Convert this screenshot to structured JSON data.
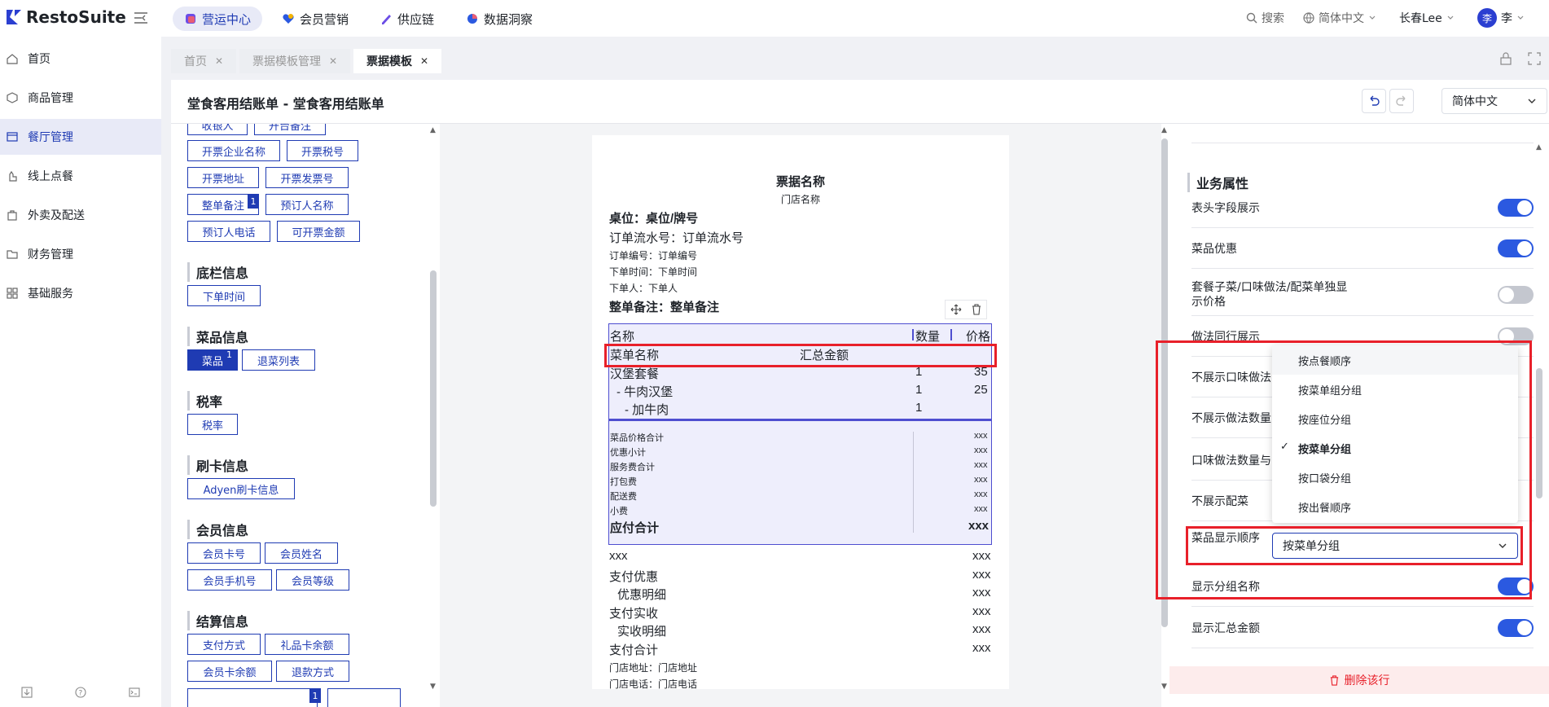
{
  "brand": {
    "name": "RestoSuite",
    "accent": "#1f3bb3",
    "red": "#e8202a"
  },
  "topnav": [
    {
      "label": "营运中心",
      "icon": "cube-icon"
    },
    {
      "label": "会员营销",
      "icon": "heart-icon"
    },
    {
      "label": "供应链",
      "icon": "pen-icon"
    },
    {
      "label": "数据洞察",
      "icon": "pie-icon"
    }
  ],
  "topright": {
    "search": "搜索",
    "language": "简体中文",
    "store": "长春Lee",
    "avatar": "李",
    "user": "李"
  },
  "sidebar": [
    {
      "label": "首页",
      "icon": "home-icon"
    },
    {
      "label": "商品管理",
      "icon": "box-icon"
    },
    {
      "label": "餐厅管理",
      "icon": "store-icon"
    },
    {
      "label": "线上点餐",
      "icon": "hand-icon"
    },
    {
      "label": "外卖及配送",
      "icon": "bag-icon"
    },
    {
      "label": "财务管理",
      "icon": "folder-icon"
    },
    {
      "label": "基础服务",
      "icon": "grid-icon"
    }
  ],
  "tabs": [
    {
      "label": "首页"
    },
    {
      "label": "票据模板管理"
    },
    {
      "label": "票据模板"
    }
  ],
  "page": {
    "title": "堂食客用结账单 - 堂食客用结账单",
    "language": "简体中文"
  },
  "left": {
    "top_tags": [
      {
        "label": "收银人"
      },
      {
        "label": "开台备注"
      },
      {
        "label": "开票企业名称"
      },
      {
        "label": "开票税号"
      },
      {
        "label": "开票地址"
      },
      {
        "label": "开票发票号"
      },
      {
        "label": "整单备注",
        "badge": "1"
      },
      {
        "label": "预订人名称"
      },
      {
        "label": "预订人电话"
      },
      {
        "label": "可开票金额"
      }
    ],
    "sections": [
      {
        "title": "底栏信息",
        "tags": [
          {
            "label": "下单时间"
          }
        ]
      },
      {
        "title": "菜品信息",
        "tags": [
          {
            "label": "菜品",
            "badge": "1"
          },
          {
            "label": "退菜列表"
          }
        ]
      },
      {
        "title": "税率",
        "tags": [
          {
            "label": "税率"
          }
        ]
      },
      {
        "title": "刷卡信息",
        "tags": [
          {
            "label": "Adyen刷卡信息"
          }
        ]
      },
      {
        "title": "会员信息",
        "tags": [
          {
            "label": "会员卡号"
          },
          {
            "label": "会员姓名"
          },
          {
            "label": "会员手机号"
          },
          {
            "label": "会员等级"
          }
        ]
      },
      {
        "title": "结算信息",
        "tags": [
          {
            "label": "支付方式"
          },
          {
            "label": "礼品卡余额"
          },
          {
            "label": "会员卡余额"
          },
          {
            "label": "退款方式"
          }
        ]
      }
    ],
    "partial_badge": "1"
  },
  "receipt": {
    "title": "票据名称",
    "store": "门店名称",
    "table": "桌位：桌位/牌号",
    "serial": "订单流水号：订单流水号",
    "order_no": "订单编号：订单编号",
    "order_time": "下单时间：下单时间",
    "orderer": "下单人：下单人",
    "remark": "整单备注：整单备注",
    "col_name": "名称",
    "col_qty": "数量",
    "col_price": "价格",
    "group_name": "菜单名称",
    "group_total": "汇总金额",
    "items": [
      {
        "name": "汉堡套餐",
        "qty": "1",
        "price": "35"
      },
      {
        "name": "- 牛肉汉堡",
        "qty": "1",
        "price": "25"
      },
      {
        "name": "- 加牛肉",
        "qty": "1",
        "price": ""
      }
    ],
    "summary": [
      {
        "label": "菜品价格合计",
        "value": "xxx"
      },
      {
        "label": "优惠小计",
        "value": "xxx"
      },
      {
        "label": "服务费合计",
        "value": "xxx"
      },
      {
        "label": "打包费",
        "value": "xxx"
      },
      {
        "label": "配送费",
        "value": "xxx"
      },
      {
        "label": "小费",
        "value": "xxx"
      }
    ],
    "total_label": "应付合计",
    "total_value": "xxx",
    "lower": [
      {
        "label": "xxx",
        "value": "xxx"
      },
      {
        "label": "支付优惠",
        "value": "xxx"
      },
      {
        "label": "优惠明细",
        "value": "xxx"
      },
      {
        "label": "支付实收",
        "value": "xxx"
      },
      {
        "label": "实收明细",
        "value": "xxx"
      },
      {
        "label": "支付合计",
        "value": "xxx"
      }
    ],
    "address": "门店地址：门店地址",
    "phone": "门店电话：门店电话"
  },
  "right": {
    "section": "业务属性",
    "rows": [
      {
        "label": "表头字段展示",
        "state": "on"
      },
      {
        "label": "菜品优惠",
        "state": "on"
      },
      {
        "label": "套餐子菜/口味做法/配菜单独显示价格",
        "state": "off"
      },
      {
        "label": "做法同行展示",
        "state": "off"
      },
      {
        "label": "不展示口味做法",
        "state": ""
      },
      {
        "label": "不展示做法数量",
        "state": ""
      },
      {
        "label": "口味做法数量与",
        "state": ""
      },
      {
        "label": "不展示配菜",
        "state": ""
      }
    ],
    "order_label": "菜品显示顺序",
    "order_value": "按菜单分组",
    "options": [
      {
        "label": "按点餐顺序",
        "checked": false
      },
      {
        "label": "按菜单组分组",
        "checked": false
      },
      {
        "label": "按座位分组",
        "checked": false
      },
      {
        "label": "按菜单分组",
        "checked": true
      },
      {
        "label": "按口袋分组",
        "checked": false
      },
      {
        "label": "按出餐顺序",
        "checked": false
      }
    ],
    "after_rows": [
      {
        "label": "显示分组名称",
        "state": "on"
      },
      {
        "label": "显示汇总金额",
        "state": "on"
      }
    ],
    "delete_label": "删除该行"
  }
}
